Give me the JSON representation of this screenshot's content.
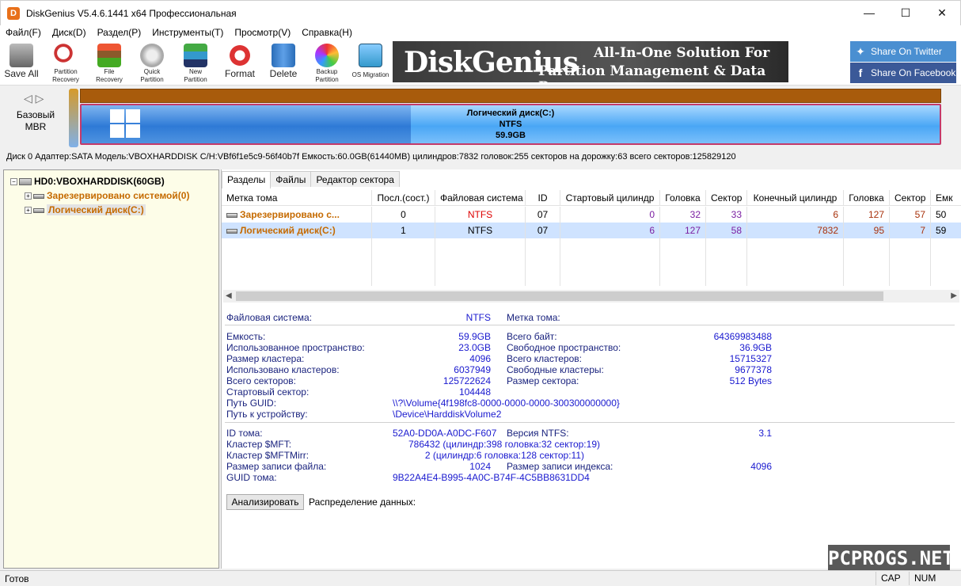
{
  "window": {
    "title": "DiskGenius V5.4.6.1441 x64 Профессиональная",
    "min": "—",
    "max": "☐",
    "close": "✕"
  },
  "menu": [
    "Файл(F)",
    "Диск(D)",
    "Раздел(P)",
    "Инструменты(T)",
    "Просмотр(V)",
    "Справка(H)"
  ],
  "toolbar": {
    "save_all": "Save All",
    "partition_recovery_1": "Partition",
    "partition_recovery_2": "Recovery",
    "file_recovery_1": "File",
    "file_recovery_2": "Recovery",
    "quick_partition_1": "Quick",
    "quick_partition_2": "Partition",
    "new_partition_1": "New",
    "new_partition_2": "Partition",
    "format": "Format",
    "delete": "Delete",
    "backup_partition_1": "Backup",
    "backup_partition_2": "Partition",
    "os_migration": "OS Migration"
  },
  "banner": {
    "brand": "DiskGenius",
    "tag1": "All-In-One Solution For",
    "tag2": "Partition Management & Data Recovery"
  },
  "social": {
    "twitter": "Share On Twitter",
    "facebook": "Share On Facebook"
  },
  "disk": {
    "type_1": "Базовый",
    "type_2": "MBR",
    "part_name": "Логический диск(C:)",
    "part_fs": "NTFS",
    "part_size": "59.9GB",
    "info": "Диск 0 Адаптер:SATA  Модель:VBOXHARDDISK  C/H:VBf6f1e5c9-56f40b7f  Емкость:60.0GB(61440MB)  цилиндров:7832  головок:255  секторов на дорожку:63  всего секторов:125829120"
  },
  "tree": {
    "disk": "HD0:VBOXHARDDISK(60GB)",
    "part1": "Зарезервировано системой(0)",
    "part2": "Логический диск(C:)"
  },
  "tabs": [
    "Разделы",
    "Файлы",
    "Редактор сектора"
  ],
  "table": {
    "headers": [
      "Метка тома",
      "Посл.(сост.)",
      "Файловая система",
      "ID",
      "Стартовый цилиндр",
      "Головка",
      "Сектор",
      "Конечный цилиндр",
      "Головка",
      "Сектор",
      "Емк"
    ],
    "rows": [
      [
        "Зарезервировано с...",
        "0",
        "NTFS",
        "07",
        "0",
        "32",
        "33",
        "6",
        "127",
        "57",
        "50"
      ],
      [
        "Логический диск(C:)",
        "1",
        "NTFS",
        "07",
        "6",
        "127",
        "58",
        "7832",
        "95",
        "7",
        "59"
      ]
    ]
  },
  "details": {
    "fs_label": "Файловая система:",
    "fs_value": "NTFS",
    "vol_label": "Метка тома:",
    "capacity_label": "Емкость:",
    "capacity_value": "59.9GB",
    "total_bytes_label": "Всего байт:",
    "total_bytes_value": "64369983488",
    "used_label": "Использованное пространство:",
    "used_value": "23.0GB",
    "free_label": "Свободное пространство:",
    "free_value": "36.9GB",
    "cluster_size_label": "Размер кластера:",
    "cluster_size_value": "4096",
    "total_clusters_label": "Всего кластеров:",
    "total_clusters_value": "15715327",
    "used_clusters_label": "Использовано кластеров:",
    "used_clusters_value": "6037949",
    "free_clusters_label": "Свободные кластеры:",
    "free_clusters_value": "9677378",
    "total_sectors_label": "Всего секторов:",
    "total_sectors_value": "125722624",
    "sector_size_label": "Размер сектора:",
    "sector_size_value": "512 Bytes",
    "start_sector_label": "Стартовый сектор:",
    "start_sector_value": "104448",
    "guid_path_label": "Путь GUID:",
    "guid_path_value": "\\\\?\\Volume{4f198fc8-0000-0000-0000-300300000000}",
    "device_path_label": "Путь к устройству:",
    "device_path_value": "\\Device\\HarddiskVolume2",
    "volume_id_label": "ID тома:",
    "volume_id_value": "52A0-DD0A-A0DC-F607",
    "ntfs_ver_label": "Версия NTFS:",
    "ntfs_ver_value": "3.1",
    "mft_label": "Кластер $MFT:",
    "mft_value": "786432 (цилиндр:398 головка:32 сектор:19)",
    "mftmirr_label": "Кластер $MFTMirr:",
    "mftmirr_value": "2 (цилиндр:6 головка:128 сектор:11)",
    "file_record_label": "Размер записи файла:",
    "file_record_value": "1024",
    "index_record_label": "Размер записи индекса:",
    "index_record_value": "4096",
    "guid_label": "GUID тома:",
    "guid_value": "9B22A4E4-B995-4A0C-B74F-4C5BB8631DD4",
    "analyze_button": "Анализировать",
    "distribution_label": "Распределение данных:"
  },
  "watermark": "PCPROGS.NET",
  "status": {
    "text": "Готов",
    "cap": "CAP",
    "num": "NUM"
  },
  "colors": {
    "accent": "#e8701a",
    "twitter": "#4a8fd1",
    "facebook": "#3b5998",
    "partition_border": "#c43a6a",
    "selection": "#cfe3ff"
  }
}
